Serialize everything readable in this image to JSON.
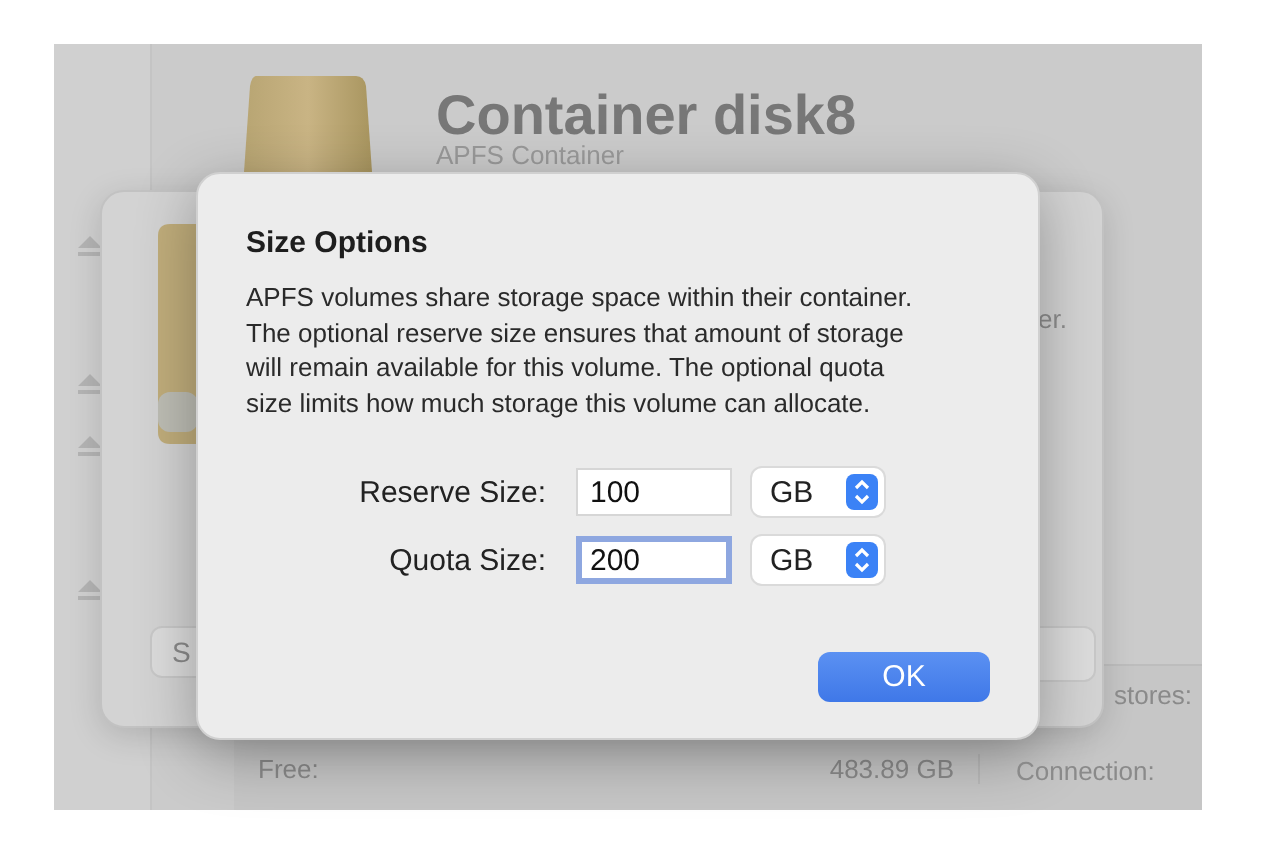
{
  "disk": {
    "title": "Container disk8",
    "subtitle": "APFS Container"
  },
  "sheet": {
    "button_label": "S",
    "text_fragment": "er."
  },
  "info_table": {
    "rows": [
      {
        "label": "Free:",
        "value": "483.89 GB"
      }
    ],
    "right_labels": [
      "stores:",
      "Connection:"
    ]
  },
  "dialog": {
    "title": "Size Options",
    "message": "APFS volumes share storage space within their container.\nThe optional reserve size ensures that amount of storage\nwill remain available for this volume. The optional quota\nsize limits how much storage this volume can allocate.",
    "fields": [
      {
        "label": "Reserve Size:",
        "value": "100",
        "unit": "GB",
        "focused": false
      },
      {
        "label": "Quota Size:",
        "value": "200",
        "unit": "GB",
        "focused": true
      }
    ],
    "button": "OK"
  }
}
